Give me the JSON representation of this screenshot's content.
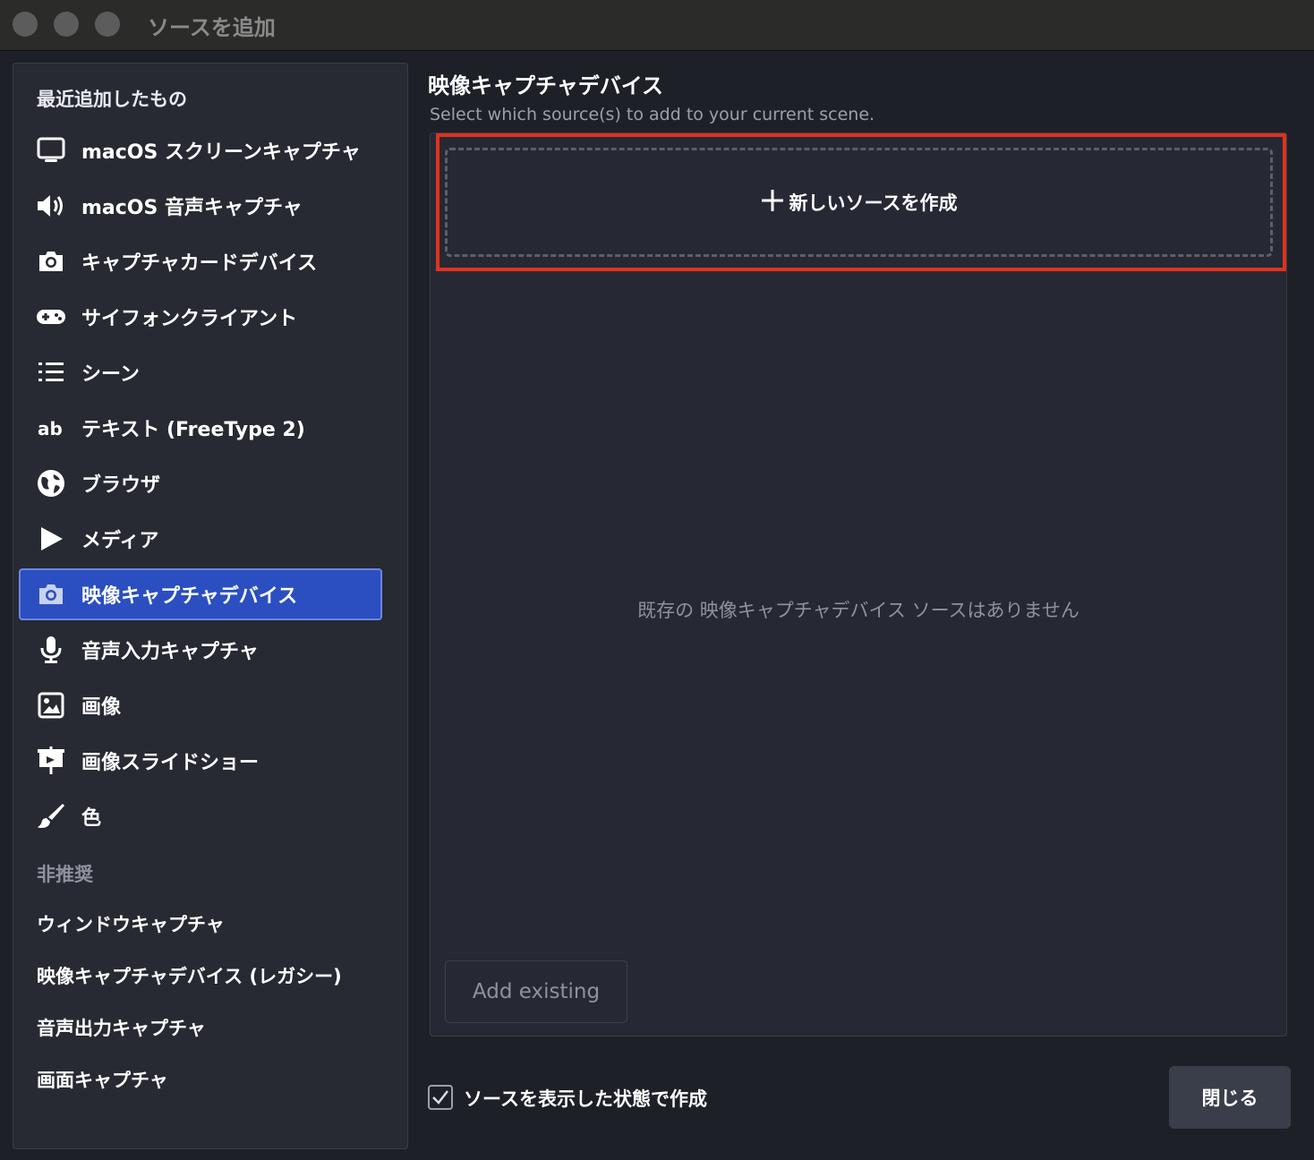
{
  "window": {
    "title": "ソースを追加"
  },
  "sidebar": {
    "recent_header": "最近追加したもの",
    "items": [
      {
        "label": "macOS スクリーンキャプチャ",
        "icon": "monitor-icon"
      },
      {
        "label": "macOS 音声キャプチャ",
        "icon": "speaker-icon"
      },
      {
        "label": "キャプチャカードデバイス",
        "icon": "camera-icon"
      },
      {
        "label": "サイフォンクライアント",
        "icon": "gamepad-icon"
      },
      {
        "label": "シーン",
        "icon": "list-icon"
      },
      {
        "label": "テキスト (FreeType 2)",
        "icon": "text-icon"
      },
      {
        "label": "ブラウザ",
        "icon": "globe-icon"
      },
      {
        "label": "メディア",
        "icon": "play-icon"
      },
      {
        "label": "映像キャプチャデバイス",
        "icon": "camera-icon",
        "selected": true
      },
      {
        "label": "音声入力キャプチャ",
        "icon": "microphone-icon"
      },
      {
        "label": "画像",
        "icon": "image-icon"
      },
      {
        "label": "画像スライドショー",
        "icon": "slideshow-icon"
      },
      {
        "label": "色",
        "icon": "brush-icon"
      }
    ],
    "deprecated_header": "非推奨",
    "deprecated_items": [
      "ウィンドウキャプチャ",
      "映像キャプチャデバイス (レガシー)",
      "音声出力キャプチャ",
      "画面キャプチャ"
    ]
  },
  "main": {
    "title": "映像キャプチャデバイス",
    "subtitle": "Select which source(s) to add to your current scene.",
    "create_new": "新しいソースを作成",
    "empty_message": "既存の 映像キャプチャデバイス ソースはありません",
    "add_existing": "Add existing"
  },
  "footer": {
    "checkbox_label": "ソースを表示した状態で作成",
    "checkbox_checked": true,
    "close_button": "閉じる"
  },
  "colors": {
    "selected": "#2b4fc0",
    "highlight": "#e0321e",
    "background": "#1e2028"
  }
}
